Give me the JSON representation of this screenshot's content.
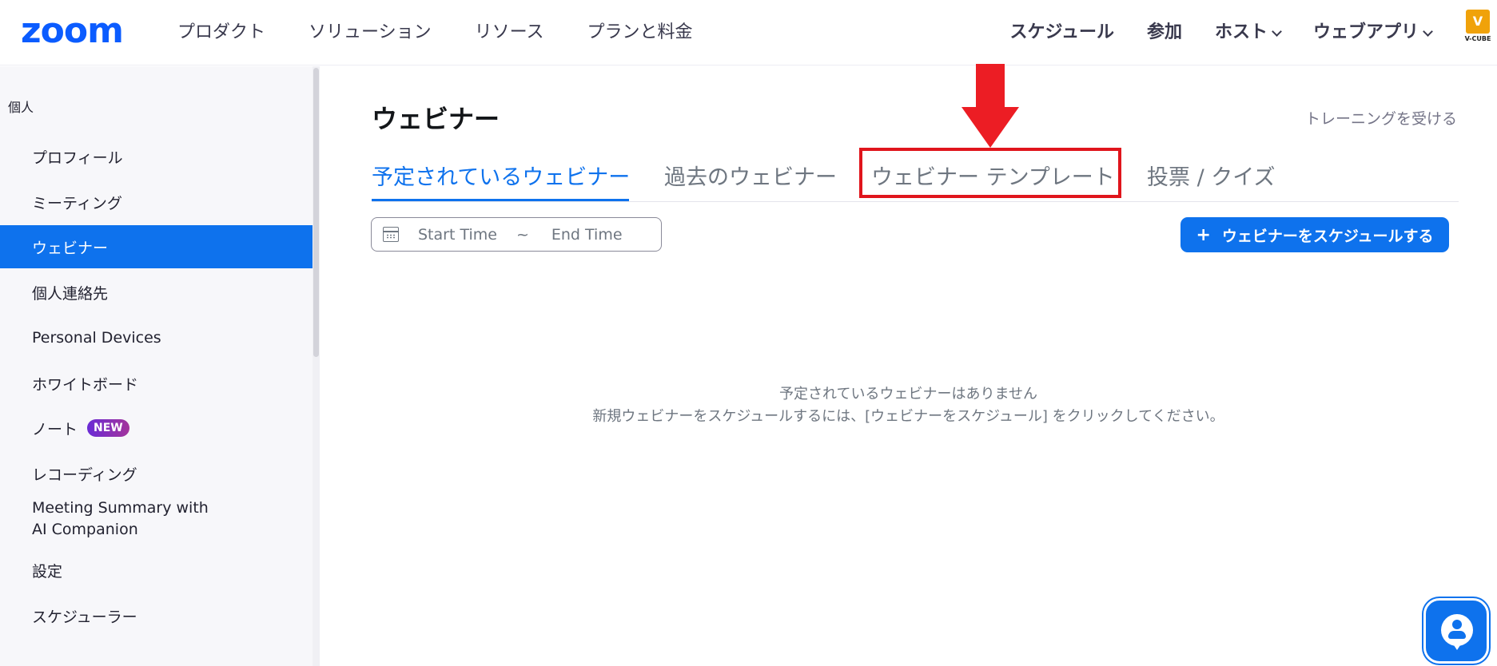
{
  "brand": {
    "logo": "zoom",
    "partner_mark": "V",
    "partner_text": "V-CUBE",
    "accent": "#0e72ed"
  },
  "nav": {
    "left": [
      "プロダクト",
      "ソリューション",
      "リソース",
      "プランと料金"
    ],
    "right": [
      {
        "label": "スケジュール",
        "dropdown": false
      },
      {
        "label": "参加",
        "dropdown": false
      },
      {
        "label": "ホスト",
        "dropdown": true
      },
      {
        "label": "ウェブアプリ",
        "dropdown": true
      }
    ]
  },
  "sidebar": {
    "heading": "個人",
    "items": [
      {
        "label": "プロフィール"
      },
      {
        "label": "ミーティング"
      },
      {
        "label": "ウェビナー",
        "active": true
      },
      {
        "label": "個人連絡先"
      },
      {
        "label": "Personal Devices"
      },
      {
        "label": "ホワイトボード"
      },
      {
        "label": "ノート",
        "badge": "NEW"
      },
      {
        "label": "レコーディング"
      },
      {
        "label": "Meeting Summary with AI Companion"
      },
      {
        "label": "設定"
      },
      {
        "label": "スケジューラー"
      }
    ]
  },
  "main": {
    "title": "ウェビナー",
    "training_link": "トレーニングを受ける",
    "tabs": [
      {
        "label": "予定されているウェビナー",
        "active": true
      },
      {
        "label": "過去のウェビナー"
      },
      {
        "label": "ウェビナー テンプレート",
        "highlighted": true
      },
      {
        "label": "投票 / クイズ"
      }
    ],
    "date_range": {
      "start_placeholder": "Start Time",
      "separator": "~",
      "end_placeholder": "End Time"
    },
    "schedule_button": {
      "icon": "+",
      "label": "ウェビナーをスケジュールする"
    },
    "empty_state": {
      "title": "予定されているウェビナーはありません",
      "subtitle": "新規ウェビナーをスケジュールするには、[ウェビナーをスケジュール] をクリックしてください。"
    }
  },
  "annotation": {
    "color": "#e0151c"
  }
}
